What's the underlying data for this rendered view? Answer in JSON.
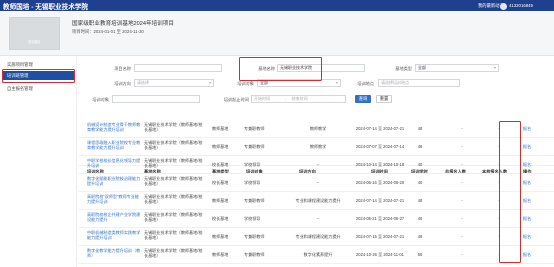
{
  "topbar": {
    "title": "教师国培 - 无锡职业技术学院",
    "home": "我的最新动态",
    "user": "4132016849"
  },
  "header": {
    "logo_caption": "暂无图片",
    "project_name": "国家级职业教育培训基地2024年培训项目",
    "project_time": "项目时间：2024-01-01 至 2024-11-30"
  },
  "sidebar": {
    "items": [
      {
        "label": "实施项目管理",
        "active": false
      },
      {
        "label": "培训班管理",
        "active": true
      },
      {
        "label": "自主报名管理",
        "active": false
      }
    ]
  },
  "filters": {
    "project_label": "项目名称",
    "base_label": "基地名称",
    "base_value": "无锡职业技术学院",
    "base_type_label": "基地类型",
    "base_type_value": "全部",
    "direction_label": "培训方向",
    "direction_placeholder": "请选择",
    "mode_label": "培训对象",
    "mode_value": "全部",
    "location_label": "培训地点",
    "location_placeholder": "请选择培训地点",
    "class_label": "培训对象",
    "time_label": "培训起止时间",
    "start_placeholder": "开始时间",
    "separator": "-",
    "end_placeholder": "结束时间",
    "search_btn": "查询",
    "reset_btn": "重置"
  },
  "table": {
    "headers": [
      "培训名称",
      "基地名称",
      "基地类型",
      "培训对象",
      "培训方向",
      "培训时间",
      "培训学时",
      "总报名人数",
      "本校报名人数",
      "操作"
    ],
    "rows": [
      {
        "name": "机械设计制造专业骨干教师教育教学能力提升培训",
        "base": "无锡职业技术学院（教师基地/校长基地）",
        "type": "教师基地",
        "target": "专兼职教师",
        "direction": "教师教学",
        "time": "2024-07-14 至 2024-07-21",
        "hours": "48",
        "total": "-",
        "school": "-",
        "op": "报名"
      },
      {
        "name": "课程思政融入职业院校专业教育教学能力提升培训",
        "base": "无锡职业技术学院（教师基地/校长基地）",
        "type": "教师基地",
        "target": "专兼职教师",
        "direction": "教师教学",
        "time": "2024-07-07 至 2024-07-14",
        "hours": "48",
        "total": "-",
        "school": "-",
        "op": "报名"
      },
      {
        "name": "中职学校校长信息化领导力提升培训",
        "base": "无锡职业技术学院（教师基地/校长基地）",
        "type": "校长基地",
        "target": "学校领导",
        "direction": "--",
        "time": "2024-10-14 至 2024-10-18",
        "hours": "40",
        "total": "-",
        "school": "-",
        "op": "报名"
      },
      {
        "name": "数字化赋能职业院校治理能力提升培训",
        "base": "无锡职业技术学院（教师基地/校长基地）",
        "type": "校长基地",
        "target": "学校领导",
        "direction": "--",
        "time": "2024-06-16 至 2024-06-20",
        "hours": "40",
        "total": "-",
        "school": "-",
        "op": "报名"
      },
      {
        "name": "高职院校“双师型”教师专业能力提升培训",
        "base": "无锡职业技术学院（教师基地/校长基地）",
        "type": "教师基地",
        "target": "专兼职教师",
        "direction": "专业和课程建设能力提升",
        "time": "2024-07-14 至 2024-07-21",
        "hours": "48",
        "total": "-",
        "school": "-",
        "op": "报名"
      },
      {
        "name": "高职院校校企共建产业学院建设能力提升",
        "base": "无锡职业技术学院（教师基地/校长基地）",
        "type": "校长基地",
        "target": "学校领导",
        "direction": "--",
        "time": "2024-06-21 至 2024-06-27",
        "hours": "40",
        "total": "-",
        "school": "-",
        "op": "报名"
      },
      {
        "name": "中职机械制造类教师实践教学能力提升培训",
        "base": "无锡职业技术学院（教师基地/校长基地）",
        "type": "教师基地",
        "target": "专兼职教师",
        "direction": "专业和课程建设能力提升",
        "time": "2024-07-15 至 2024-07-21",
        "hours": "48",
        "total": "-",
        "school": "-",
        "op": "报名"
      },
      {
        "name": "数字化教学能力提升培训（教师）",
        "base": "无锡职业技术学院（教师基地/校长基地）",
        "type": "教师基地",
        "target": "专兼职教师",
        "direction": "数字化素养提升",
        "time": "2024-10-26 至 2024-11-01",
        "hours": "56",
        "total": "-",
        "school": "-",
        "op": "报名"
      }
    ]
  }
}
